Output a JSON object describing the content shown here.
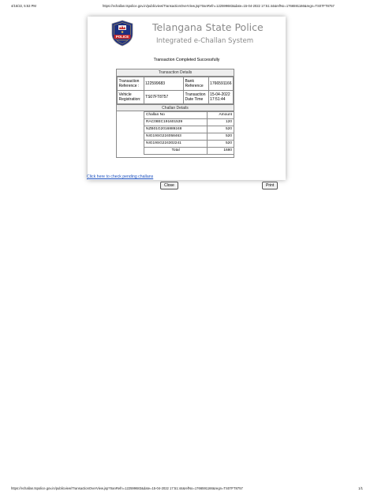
{
  "print_header": {
    "date": "4/15/22, 5:53 PM",
    "url": "https://echallan.tspolice.gov.in/publicview/TransactionOverView.jsp?tranRefn=122599683&date=15-04-2022 17:51:44&refNo=1766591166&regn=TS07FT8757"
  },
  "print_footer": {
    "url": "https://echallan.tspolice.gov.in/publicview/TransactionOverView.jsp?tranRefn=122599683&date=15-04-2022 17:51:44&refNo=1766591166&regn=TS07FT8757",
    "page": "1/1"
  },
  "banner": {
    "title": "Telangana State Police",
    "subtitle": "Integrated e-Challan System",
    "logo_text": "POLICE",
    "logo_icon": "police-emblem-icon"
  },
  "status_message": "Transaction Completed Successfully",
  "transaction_details": {
    "heading": "Transaction Details",
    "transaction_reference_label": "Transaction Reference :",
    "transaction_reference_value": "122599683",
    "bank_reference_label": "Bank Reference",
    "bank_reference_value": "1766591166",
    "vehicle_registration_label": "Vehicle Registration:",
    "vehicle_registration_value": "TS07FT8757",
    "transaction_date_label": "Transaction Date Time",
    "transaction_date_value": "15-04-2022 17:51:44"
  },
  "challan_details": {
    "heading": "Challan Details",
    "columns": [
      "Challan No",
      "Amount"
    ],
    "rows": [
      {
        "challan_no": "RAC08EC191601539",
        "amount": "120"
      },
      {
        "challan_no": "NZB01G2016889248",
        "amount": "520"
      },
      {
        "challan_no": "NIG19SG224058463",
        "amount": "520"
      },
      {
        "challan_no": "NIG19SG224302241",
        "amount": "520"
      }
    ],
    "total_label": "Total",
    "total_value": "1680"
  },
  "buttons": {
    "close": "Close",
    "print": "Print"
  },
  "pending_link": "Click here to check pending challans",
  "colors": {
    "title_gray": "#8a8a8a",
    "logo_blue": "#1c2f80",
    "logo_red": "#c62828",
    "link_blue": "#1a4fbf"
  }
}
